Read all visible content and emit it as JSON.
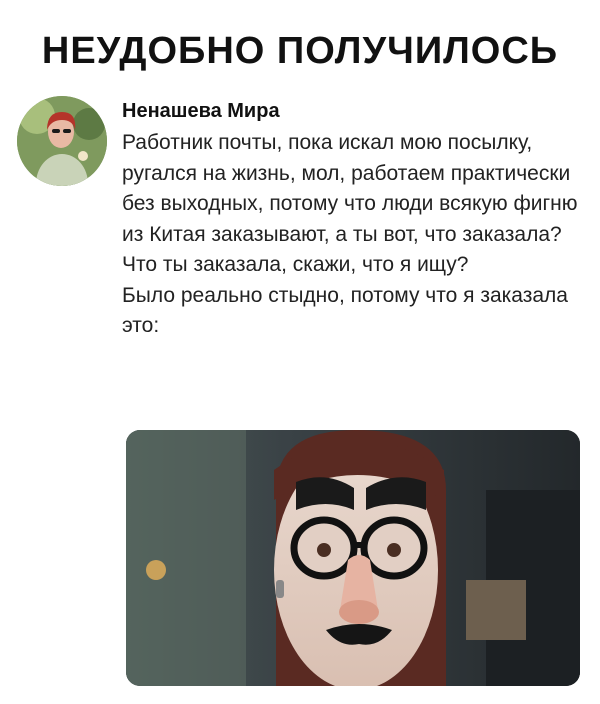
{
  "headline": "НЕУДОБНО ПОЛУЧИЛОСЬ",
  "post": {
    "author": "Ненашева Мира",
    "paragraph_1": "Работник почты, пока искал мою посылку, ругался на жизнь, мол, работаем практически без выходных, потому что люди всякую фигню из Китая заказывают, а ты вот, что заказала? Что ты заказала, скажи, что я ищу?",
    "paragraph_2": "Было реально стыдно, потому что я заказала это:",
    "avatar_icon": "user-avatar-photo",
    "attached_photo_icon": "groucho-glasses-photo"
  }
}
